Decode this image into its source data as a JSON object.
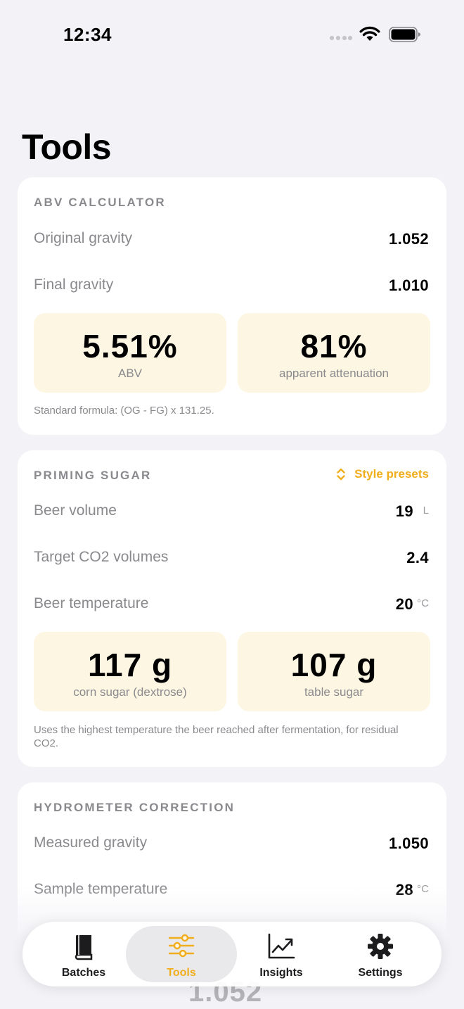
{
  "status_bar": {
    "time": "12:34"
  },
  "page": {
    "title": "Tools"
  },
  "abv": {
    "section_title": "ABV CALCULATOR",
    "og_label": "Original gravity",
    "og_value": "1.052",
    "fg_label": "Final gravity",
    "fg_value": "1.010",
    "abv_value": "5.51%",
    "abv_label": "ABV",
    "attenuation_value": "81%",
    "attenuation_label": "apparent attenuation",
    "note": "Standard formula: (OG - FG) x 131.25."
  },
  "priming": {
    "section_title": "PRIMING SUGAR",
    "presets_label": "Style presets",
    "volume_label": "Beer volume",
    "volume_value": "19",
    "volume_unit": "L",
    "co2_label": "Target CO2 volumes",
    "co2_value": "2.4",
    "temp_label": "Beer temperature",
    "temp_value": "20",
    "temp_unit": "°C",
    "corn_value": "117 g",
    "corn_label": "corn sugar (dextrose)",
    "table_value": "107 g",
    "table_label": "table sugar",
    "note": "Uses the highest temperature the beer reached after fermentation, for residual CO2."
  },
  "hydro": {
    "section_title": "HYDROMETER CORRECTION",
    "measured_label": "Measured gravity",
    "measured_value": "1.050",
    "sample_label": "Sample temperature",
    "sample_value": "28",
    "sample_unit": "°C",
    "partial_result": "1.052"
  },
  "tab_bar": {
    "active_tab": "Tools",
    "accent_color": "#f0ad1c",
    "tabs": [
      {
        "label": "Batches",
        "icon": "book-icon"
      },
      {
        "label": "Tools",
        "icon": "sliders-icon"
      },
      {
        "label": "Insights",
        "icon": "chart-icon"
      },
      {
        "label": "Settings",
        "icon": "gear-icon"
      }
    ]
  }
}
